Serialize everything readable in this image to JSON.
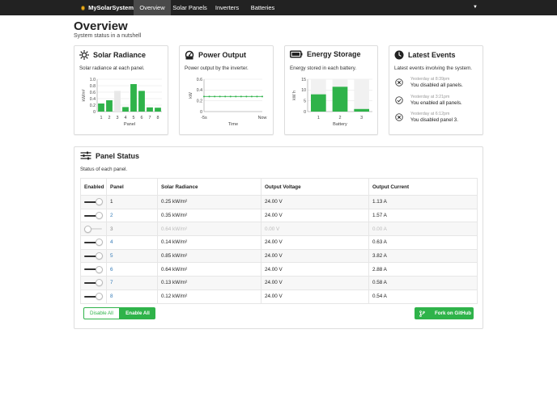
{
  "navbar": {
    "brand": "MySolarSystem",
    "items": [
      {
        "label": "Overview",
        "active": true
      },
      {
        "label": "Solar Panels",
        "active": false
      },
      {
        "label": "Inverters",
        "active": false
      },
      {
        "label": "Batteries",
        "active": false
      }
    ],
    "caret": "▼"
  },
  "header": {
    "title": "Overview",
    "subtitle": "System status in a nutshell"
  },
  "cards": {
    "solar": {
      "title": "Solar Radiance",
      "desc": "Solar radiance at each panel."
    },
    "power": {
      "title": "Power Output",
      "desc": "Power output by the inverter."
    },
    "energy": {
      "title": "Energy Storage",
      "desc": "Energy stored in each battery."
    },
    "events": {
      "title": "Latest Events",
      "desc": "Latest events involving the system."
    }
  },
  "events": [
    {
      "time": "Yesterday at 8:39pm",
      "text": "You disabled all panels.",
      "icon": "x-circle-icon"
    },
    {
      "time": "Yesterday at 3:21pm",
      "text": "You enabled all panels.",
      "icon": "check-circle-icon"
    },
    {
      "time": "Yesterday at 6:12pm",
      "text": "You disabled panel 3.",
      "icon": "x-circle-icon"
    }
  ],
  "chart_data": [
    {
      "type": "bar",
      "categories": [
        "1",
        "2",
        "3",
        "4",
        "5",
        "6",
        "7",
        "8"
      ],
      "values": [
        0.25,
        0.35,
        0.64,
        0.14,
        0.85,
        0.64,
        0.13,
        0.12
      ],
      "enabled": [
        true,
        true,
        false,
        true,
        true,
        true,
        true,
        true
      ],
      "xlabel": "Panel",
      "ylabel": "kW/m²",
      "yticks": [
        "0",
        "0.2",
        "0.4",
        "0.6",
        "0.8",
        "1.0"
      ],
      "ylim": [
        0,
        1.0
      ],
      "grid": true
    },
    {
      "type": "line",
      "x": [
        "-5s",
        "Now"
      ],
      "values": [
        0.28,
        0.28,
        0.28,
        0.28,
        0.28,
        0.28,
        0.28,
        0.28,
        0.28,
        0.28,
        0.28,
        0.28
      ],
      "xlabel": "Time",
      "ylabel": "kW",
      "yticks": [
        "0",
        "0.2",
        "0.4",
        "0.6"
      ],
      "ylim": [
        0,
        0.6
      ],
      "grid": true
    },
    {
      "type": "bar",
      "categories": [
        "1",
        "2",
        "3"
      ],
      "values": [
        8,
        11.5,
        1.2
      ],
      "capacity": [
        15,
        15,
        15
      ],
      "xlabel": "Battery",
      "ylabel": "kW h",
      "yticks": [
        "0",
        "5",
        "10",
        "15"
      ],
      "ylim": [
        0,
        15
      ],
      "grid": true
    }
  ],
  "panel_status": {
    "title": "Panel Status",
    "desc": "Status of each panel.",
    "columns": [
      "Enabled",
      "Panel",
      "Solar Radiance",
      "Output Voltage",
      "Output Current"
    ],
    "rows": [
      {
        "enabled": true,
        "panel": "1",
        "radiance": "0.25 kW/m²",
        "voltage": "24.00 V",
        "current": "1.13 A"
      },
      {
        "enabled": true,
        "panel": "2",
        "radiance": "0.35 kW/m²",
        "voltage": "24.00 V",
        "current": "1.57 A"
      },
      {
        "enabled": false,
        "panel": "3",
        "radiance": "0.64 kW/m²",
        "voltage": "0.00 V",
        "current": "0.00 A"
      },
      {
        "enabled": true,
        "panel": "4",
        "radiance": "0.14 kW/m²",
        "voltage": "24.00 V",
        "current": "0.63 A"
      },
      {
        "enabled": true,
        "panel": "5",
        "radiance": "0.85 kW/m²",
        "voltage": "24.00 V",
        "current": "3.82 A"
      },
      {
        "enabled": true,
        "panel": "6",
        "radiance": "0.64 kW/m²",
        "voltage": "24.00 V",
        "current": "2.88 A"
      },
      {
        "enabled": true,
        "panel": "7",
        "radiance": "0.13 kW/m²",
        "voltage": "24.00 V",
        "current": "0.58 A"
      },
      {
        "enabled": true,
        "panel": "8",
        "radiance": "0.12 kW/m²",
        "voltage": "24.00 V",
        "current": "0.54 A"
      }
    ],
    "disable_all": "Disable All",
    "enable_all": "Enable All",
    "github": "Fork on GitHub"
  },
  "colors": {
    "accent": "#2fb34a",
    "navbar": "#222222",
    "link": "#337ab7",
    "bar_disabled": "#e8e8e8"
  }
}
